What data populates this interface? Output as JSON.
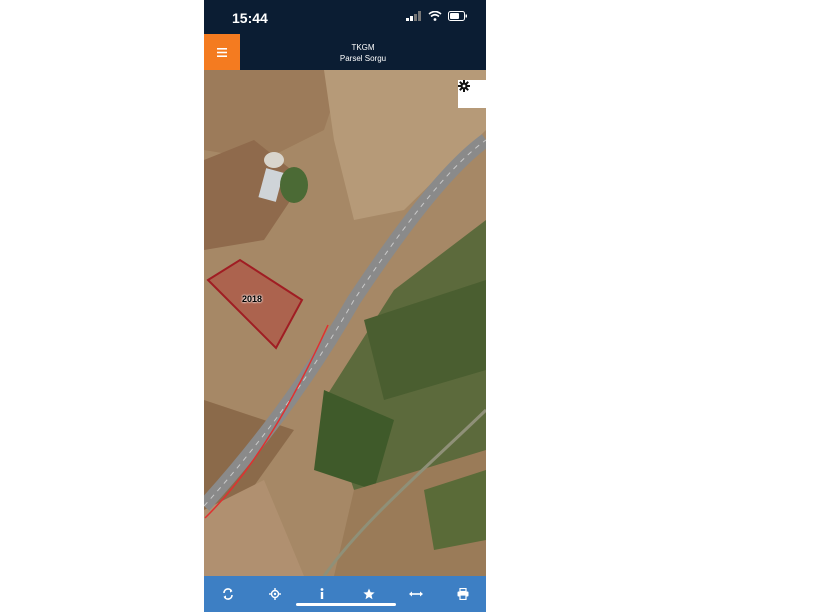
{
  "status_bar": {
    "time": "15:44"
  },
  "header": {
    "title": "TKGM",
    "subtitle": "Parsel Sorgu"
  },
  "map": {
    "parcel_label": "2018"
  },
  "toolbar": {
    "icons": [
      "refresh-icon",
      "locate-icon",
      "info-icon",
      "star-icon",
      "measure-icon",
      "print-icon"
    ]
  },
  "colors": {
    "accent": "#f47b20",
    "header_bg": "#0b1d33",
    "toolbar_bg": "#3d7fc4",
    "parcel": "#b01e23"
  }
}
